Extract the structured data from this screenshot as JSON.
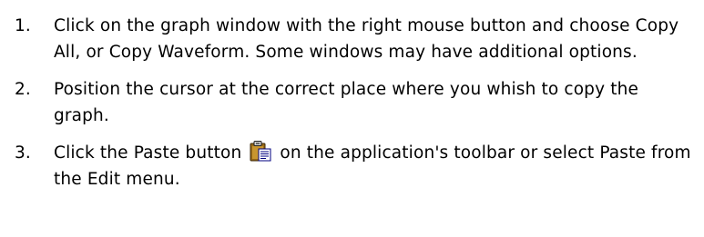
{
  "steps": [
    {
      "number": "1.",
      "text": "Click on the graph window with the right mouse button and choose Copy All, or Copy Waveform. Some windows may have additional options."
    },
    {
      "number": "2.",
      "text": "Position the cursor at the correct place where you whish to copy the graph."
    },
    {
      "number": "3.",
      "text_before_icon": "Click the Paste button",
      "icon": "paste-clipboard-icon",
      "text_after_icon": "on the application's toolbar or select Paste from the Edit menu."
    }
  ],
  "colors": {
    "text": "#000000",
    "background": "#ffffff"
  }
}
